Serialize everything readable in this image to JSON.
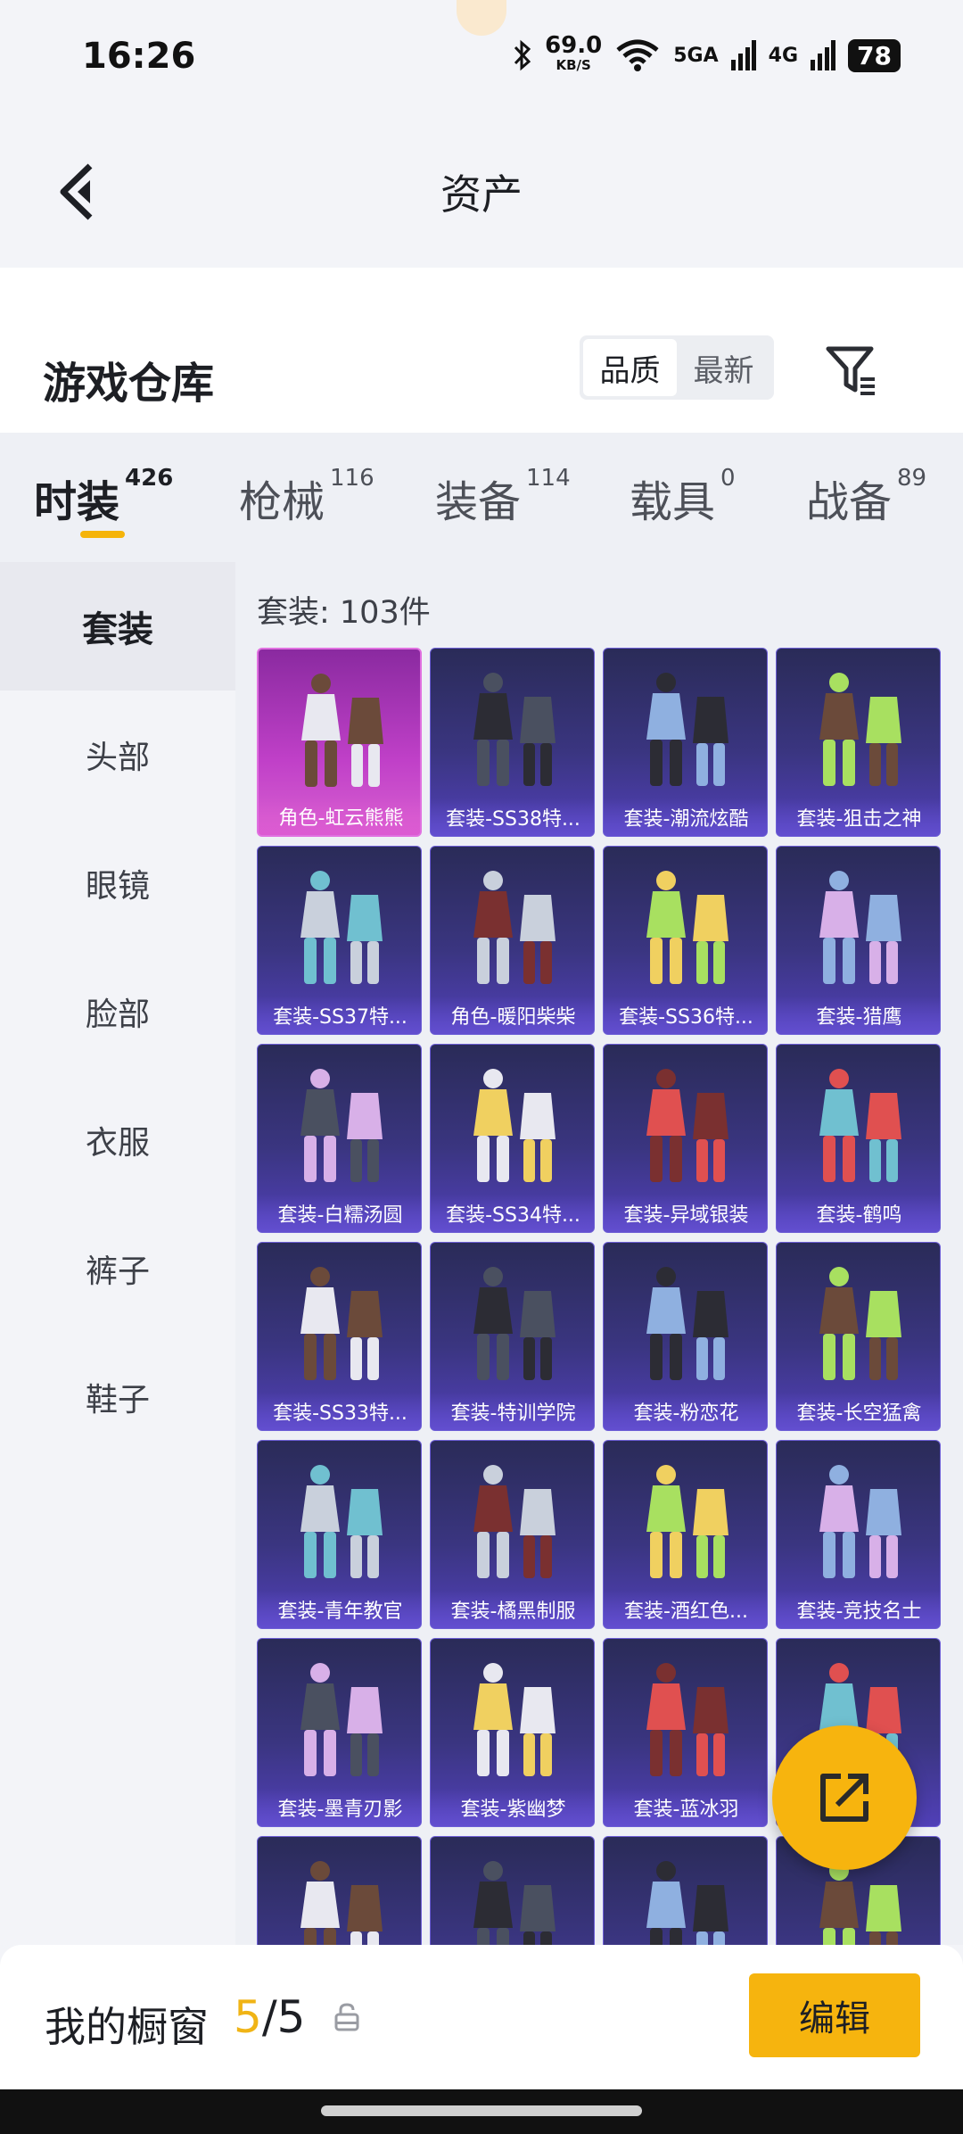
{
  "status_bar": {
    "time": "16:26",
    "speed_value": "69.0",
    "speed_unit": "KB/S",
    "net1": "5GA",
    "net2": "4G",
    "battery": "78"
  },
  "header": {
    "title": "资产"
  },
  "warehouse": {
    "title": "游戏仓库",
    "sort_options": [
      "品质",
      "最新"
    ],
    "active_sort": "品质"
  },
  "tabs": [
    {
      "label": "时装",
      "count": "426",
      "active": true
    },
    {
      "label": "枪械",
      "count": "116"
    },
    {
      "label": "装备",
      "count": "114"
    },
    {
      "label": "载具",
      "count": "0"
    },
    {
      "label": "战备",
      "count": "89"
    }
  ],
  "sidebar": {
    "items": [
      "套装",
      "头部",
      "眼镜",
      "脸部",
      "衣服",
      "裤子",
      "鞋子"
    ],
    "active": "套装"
  },
  "grid": {
    "count_text": "套装: 103件",
    "items": [
      {
        "name": "角色-虹云熊熊",
        "highlight": true
      },
      {
        "name": "套装-SS38特..."
      },
      {
        "name": "套装-潮流炫酷"
      },
      {
        "name": "套装-狙击之神"
      },
      {
        "name": "套装-SS37特..."
      },
      {
        "name": "角色-暖阳柴柴"
      },
      {
        "name": "套装-SS36特..."
      },
      {
        "name": "套装-猎鹰"
      },
      {
        "name": "套装-白糯汤圆"
      },
      {
        "name": "套装-SS34特..."
      },
      {
        "name": "套装-异域银装"
      },
      {
        "name": "套装-鹤鸣"
      },
      {
        "name": "套装-SS33特..."
      },
      {
        "name": "套装-特训学院"
      },
      {
        "name": "套装-粉恋花"
      },
      {
        "name": "套装-长空猛禽"
      },
      {
        "name": "套装-青年教官"
      },
      {
        "name": "套装-橘黑制服"
      },
      {
        "name": "套装-酒红色..."
      },
      {
        "name": "套装-竞技名士"
      },
      {
        "name": "套装-墨青刃影"
      },
      {
        "name": "套装-紫幽梦"
      },
      {
        "name": "套装-蓝冰羽"
      },
      {
        "name": ""
      },
      {
        "name": ""
      },
      {
        "name": ""
      },
      {
        "name": ""
      },
      {
        "name": ""
      }
    ]
  },
  "showcase": {
    "label": "我的橱窗",
    "current": "5",
    "sep": "/",
    "max": "5",
    "edit_label": "编辑"
  },
  "colors": {
    "accent": "#f6b40e",
    "card_bg": "#3a3580",
    "highlight_card": "#c040c8"
  }
}
